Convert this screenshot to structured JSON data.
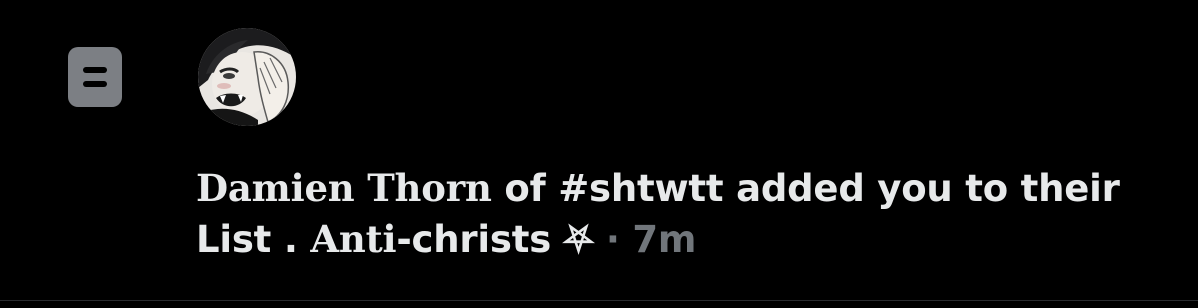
{
  "notification": {
    "icon": "list-icon",
    "avatar": "avatar-anime-character",
    "message": {
      "actor_first": "Damien",
      "actor_last": "Thorn",
      "actor_suffix": " of #shtwtt added you to their List . ",
      "list_name_serif": "Anti",
      "list_name_rest": "-christs",
      "list_symbol": "⛧",
      "separator": " · ",
      "time": "7m"
    }
  },
  "colors": {
    "background": "#000000",
    "text_primary": "#e7e9ea",
    "text_secondary": "#71767b",
    "icon_bg": "#7c7f84"
  }
}
